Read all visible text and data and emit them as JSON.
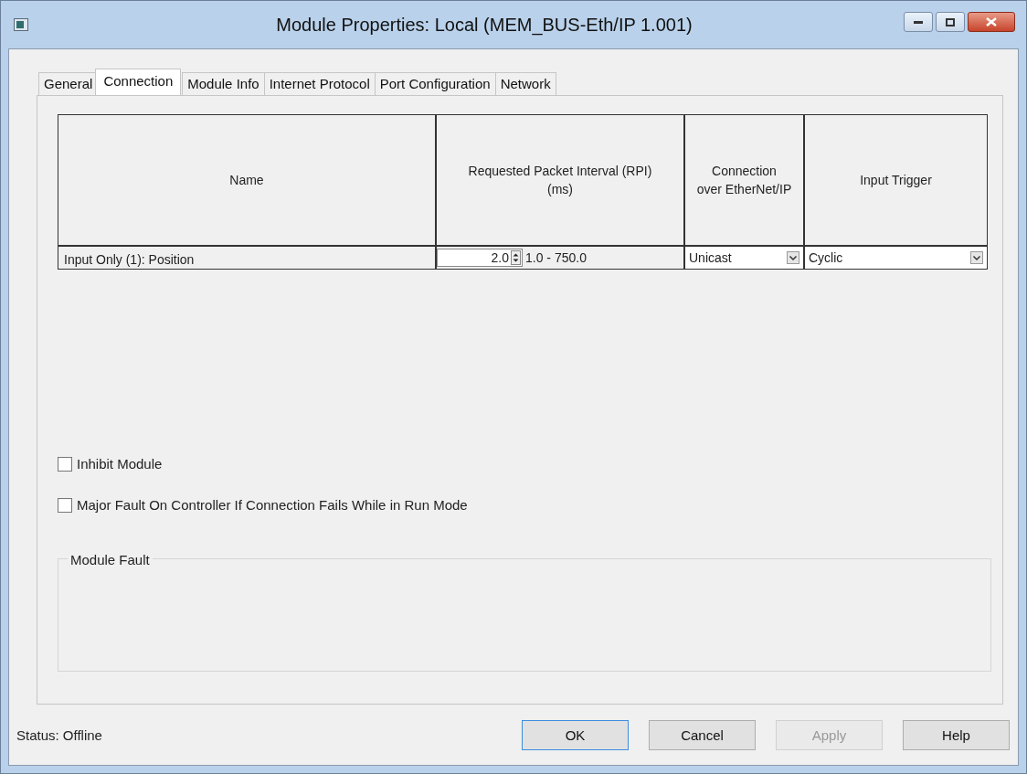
{
  "window": {
    "title": "Module Properties: Local (MEM_BUS-Eth/IP 1.001)"
  },
  "tabs": [
    {
      "label": "General",
      "selected": false
    },
    {
      "label": "Connection",
      "selected": true
    },
    {
      "label": "Module Info",
      "selected": false
    },
    {
      "label": "Internet Protocol",
      "selected": false
    },
    {
      "label": "Port Configuration",
      "selected": false
    },
    {
      "label": "Network",
      "selected": false
    }
  ],
  "table": {
    "columns": [
      "Name",
      "Requested Packet Interval (RPI)\n(ms)",
      "Connection\nover EtherNet/IP",
      "Input Trigger"
    ],
    "rows": [
      {
        "name": "Input Only (1): Position",
        "rpi": "2.0",
        "rpi_range": "1.0 - 750.0",
        "connection": "Unicast",
        "input_trigger": "Cyclic"
      }
    ]
  },
  "options": [
    {
      "label": "Inhibit Module",
      "checked": false
    },
    {
      "label": "Major Fault On Controller If Connection Fails While in Run Mode",
      "checked": false
    }
  ],
  "module_fault": {
    "title": "Module Fault"
  },
  "status": "Status:  Offline",
  "buttons": [
    {
      "label": "OK",
      "disabled": false,
      "default": true
    },
    {
      "label": "Cancel",
      "disabled": false,
      "default": false
    },
    {
      "label": "Apply",
      "disabled": true,
      "default": false
    },
    {
      "label": "Help",
      "disabled": false,
      "default": false
    }
  ]
}
